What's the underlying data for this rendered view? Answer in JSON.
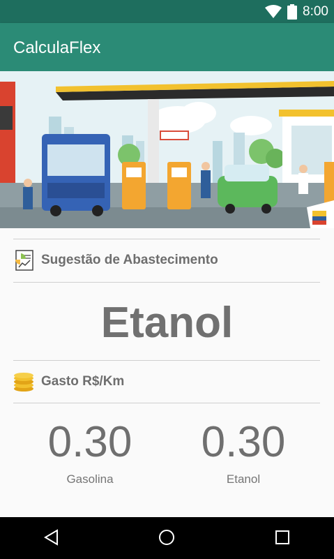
{
  "status_bar": {
    "time": "8:00",
    "icons": [
      "wifi-icon",
      "battery-icon"
    ]
  },
  "app_bar": {
    "title": "CalculaFlex"
  },
  "banner": {
    "image": "gas-station-illustration"
  },
  "suggestion_section": {
    "icon": "chart-report-icon",
    "label": "Sugestão de Abastecimento",
    "value": "Etanol"
  },
  "cost_section": {
    "icon": "coins-icon",
    "label": "Gasto R$/Km"
  },
  "metrics": [
    {
      "value": "0.30",
      "label": "Gasolina"
    },
    {
      "value": "0.30",
      "label": "Etanol"
    }
  ],
  "nav": {
    "buttons": [
      "back-icon",
      "home-icon",
      "recents-icon"
    ]
  },
  "colors": {
    "primary": "#2b8b76",
    "primary_dark": "#1e6e5e",
    "text_gray": "#707070"
  }
}
